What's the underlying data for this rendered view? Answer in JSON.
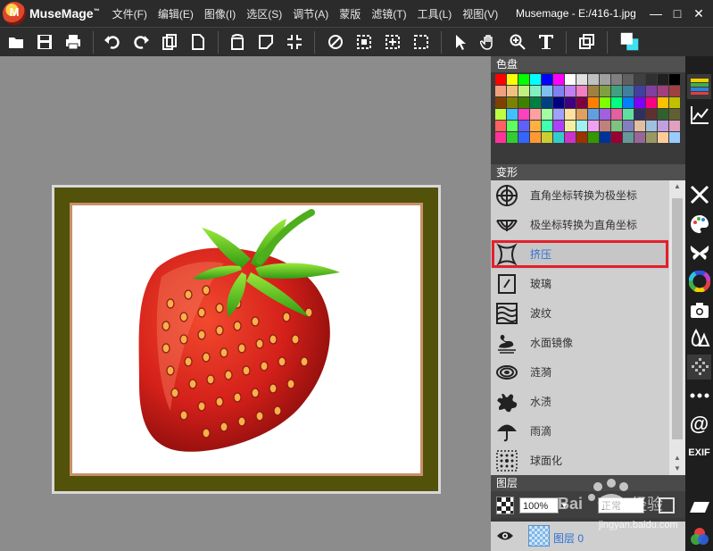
{
  "app": {
    "name": "MuseMage",
    "trademark": "™"
  },
  "menu": [
    "文件(F)",
    "编辑(E)",
    "图像(I)",
    "选区(S)",
    "调节(A)",
    "蒙版",
    "滤镜(T)",
    "工具(L)",
    "视图(V)"
  ],
  "document": {
    "title": "Musemage - E:/416-1.jpg"
  },
  "window_controls": {
    "minimize": "—",
    "maximize": "□",
    "close": "✕"
  },
  "toolbar": {
    "icons": [
      "open-icon",
      "save-icon",
      "print-icon",
      "undo-icon",
      "redo-icon",
      "copy-icon",
      "new-icon",
      "rotate-icon",
      "transform-icon",
      "fit-icon",
      "deselect-icon",
      "select-rect-icon",
      "select-center-icon",
      "select-crop-icon",
      "pointer-icon",
      "hand-icon",
      "zoom-icon",
      "text-icon",
      "layers-copy-icon",
      "color-swap-icon"
    ]
  },
  "palette": {
    "title": "色盘",
    "colors": [
      "#ff0000",
      "#ffff00",
      "#00ff00",
      "#00ffff",
      "#0000ff",
      "#ff00ff",
      "#ffffff",
      "#e0e0e0",
      "#c0c0c0",
      "#a0a0a0",
      "#808080",
      "#606060",
      "#404040",
      "#303030",
      "#202020",
      "#000000",
      "#f0a080",
      "#f0c080",
      "#c0f080",
      "#80f0c0",
      "#80c0f0",
      "#8080f0",
      "#c080f0",
      "#f080c0",
      "#a08040",
      "#80a040",
      "#40a080",
      "#4080a0",
      "#4040a0",
      "#8040a0",
      "#a04080",
      "#a04040",
      "#804000",
      "#808000",
      "#408000",
      "#008040",
      "#004080",
      "#000080",
      "#400080",
      "#800040",
      "#ff8000",
      "#80ff00",
      "#00ff80",
      "#0080ff",
      "#8000ff",
      "#ff0080",
      "#ffc000",
      "#c0c000",
      "#c0ff40",
      "#40c0ff",
      "#ff40c0",
      "#ffa0a0",
      "#a0ffa0",
      "#a0a0ff",
      "#ffe0a0",
      "#e0a060",
      "#60a0e0",
      "#a060e0",
      "#e060a0",
      "#60e0a0",
      "#303060",
      "#603030",
      "#306030",
      "#606030",
      "#ff6060",
      "#60ff60",
      "#6060ff",
      "#ffb040",
      "#40ffb0",
      "#b040ff",
      "#f0f0a0",
      "#a0f0f0",
      "#f0a0f0",
      "#c08080",
      "#80c080",
      "#8080c0",
      "#e0c0a0",
      "#a0c0e0",
      "#c0a0e0",
      "#e0a0c0",
      "#ff3399",
      "#33cc33",
      "#3366ff",
      "#ff9933",
      "#cccc33",
      "#33cccc",
      "#cc33cc",
      "#993300",
      "#339900",
      "#003399",
      "#990033",
      "#669999",
      "#996699",
      "#999966",
      "#ffcc99",
      "#99ccff"
    ]
  },
  "transform": {
    "title": "变形",
    "items": [
      {
        "label": "直角坐标转换为极坐标",
        "icon": "polar-icon"
      },
      {
        "label": "极坐标转换为直角坐标",
        "icon": "rect-coord-icon"
      },
      {
        "label": "挤压",
        "icon": "squeeze-icon",
        "selected": true
      },
      {
        "label": "玻璃",
        "icon": "glass-icon"
      },
      {
        "label": "波纹",
        "icon": "wave-icon"
      },
      {
        "label": "水面镜像",
        "icon": "swan-icon"
      },
      {
        "label": "涟漪",
        "icon": "ripple-icon"
      },
      {
        "label": "水渍",
        "icon": "splash-icon"
      },
      {
        "label": "雨滴",
        "icon": "umbrella-icon"
      },
      {
        "label": "球面化",
        "icon": "spherize-icon"
      }
    ]
  },
  "layers": {
    "title": "图层",
    "opacity": "100%",
    "blend_mode": "正常",
    "layer_name": "图层 0"
  },
  "watermark": {
    "text": "jingyan.baidu.com",
    "brand": "Bai 经验"
  }
}
